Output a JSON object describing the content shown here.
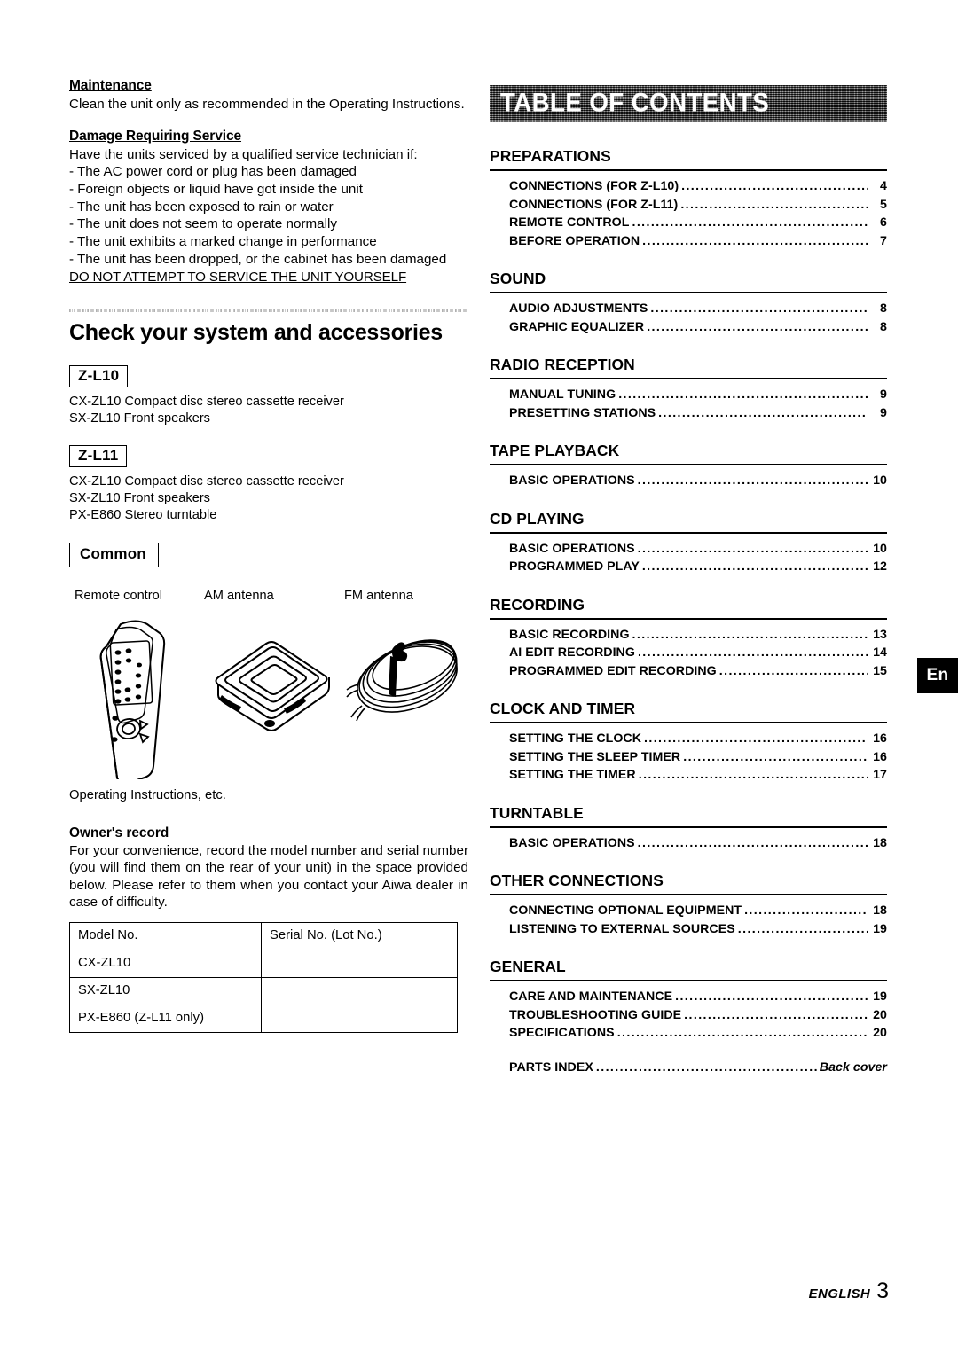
{
  "left": {
    "maintenance": {
      "heading": "Maintenance",
      "body": "Clean the unit only as recommended in the Operating Instructions."
    },
    "damage": {
      "heading": "Damage Requiring Service",
      "intro": "Have the units serviced by a qualified service technician if:",
      "items": [
        "- The AC power cord or plug has been damaged",
        "- Foreign objects or liquid have got inside the unit",
        "- The unit has been exposed to rain or water",
        "- The unit does not seem to operate normally",
        "- The unit exhibits a marked change in performance",
        "- The unit has been dropped, or the cabinet has been damaged"
      ],
      "warning": "DO NOT ATTEMPT TO SERVICE THE UNIT YOURSELF"
    },
    "check_heading": "Check your system and accessories",
    "packages": [
      {
        "label": "Z-L10",
        "contents": [
          "CX-ZL10 Compact disc stereo cassette receiver",
          "SX-ZL10 Front speakers"
        ]
      },
      {
        "label": "Z-L11",
        "contents": [
          "CX-ZL10 Compact disc stereo cassette receiver",
          "SX-ZL10 Front speakers",
          "PX-E860 Stereo turntable"
        ]
      }
    ],
    "common": {
      "label": "Common",
      "accessories": [
        {
          "name": "Remote control",
          "icon": "remote-control-icon"
        },
        {
          "name": "AM antenna",
          "icon": "am-loop-antenna-icon"
        },
        {
          "name": "FM antenna",
          "icon": "fm-wire-antenna-icon"
        }
      ],
      "extra": "Operating Instructions, etc."
    },
    "owner": {
      "heading": "Owner's record",
      "body": "For your convenience, record the model number and serial number (you will find them on the rear of your unit) in the space provided below. Please refer to them when you contact your Aiwa dealer in case of difficulty.",
      "table": {
        "headers": [
          "Model No.",
          "Serial No. (Lot No.)"
        ],
        "rows": [
          [
            "CX-ZL10",
            ""
          ],
          [
            "SX-ZL10",
            ""
          ],
          [
            "PX-E860 (Z-L11 only)",
            ""
          ]
        ]
      }
    }
  },
  "right": {
    "banner_title": "TABLE OF CONTENTS",
    "groups": [
      {
        "title": "PREPARATIONS",
        "entries": [
          {
            "label": "CONNECTIONS (FOR Z-L10)",
            "page": "4"
          },
          {
            "label": "CONNECTIONS (FOR Z-L11)",
            "page": "5"
          },
          {
            "label": "REMOTE CONTROL",
            "page": "6"
          },
          {
            "label": "BEFORE OPERATION",
            "page": "7"
          }
        ]
      },
      {
        "title": "SOUND",
        "entries": [
          {
            "label": "AUDIO ADJUSTMENTS",
            "page": "8"
          },
          {
            "label": "GRAPHIC EQUALIZER",
            "page": "8"
          }
        ]
      },
      {
        "title": "RADIO RECEPTION",
        "entries": [
          {
            "label": "MANUAL TUNING",
            "page": "9"
          },
          {
            "label": "PRESETTING STATIONS",
            "page": "9"
          }
        ]
      },
      {
        "title": "TAPE PLAYBACK",
        "entries": [
          {
            "label": "BASIC OPERATIONS",
            "page": "10"
          }
        ]
      },
      {
        "title": "CD PLAYING",
        "entries": [
          {
            "label": "BASIC OPERATIONS",
            "page": "10"
          },
          {
            "label": "PROGRAMMED PLAY",
            "page": "12"
          }
        ]
      },
      {
        "title": "RECORDING",
        "entries": [
          {
            "label": "BASIC RECORDING",
            "page": "13"
          },
          {
            "label": "AI EDIT RECORDING",
            "page": "14"
          },
          {
            "label": "PROGRAMMED EDIT RECORDING",
            "page": "15"
          }
        ]
      },
      {
        "title": "CLOCK AND TIMER",
        "entries": [
          {
            "label": "SETTING THE CLOCK",
            "page": "16"
          },
          {
            "label": "SETTING THE SLEEP TIMER",
            "page": "16"
          },
          {
            "label": "SETTING THE TIMER",
            "page": "17"
          }
        ]
      },
      {
        "title": "TURNTABLE",
        "entries": [
          {
            "label": "BASIC OPERATIONS",
            "page": "18"
          }
        ]
      },
      {
        "title": "OTHER CONNECTIONS",
        "entries": [
          {
            "label": "CONNECTING OPTIONAL EQUIPMENT",
            "page": "18"
          },
          {
            "label": "LISTENING TO EXTERNAL SOURCES",
            "page": "19"
          }
        ]
      },
      {
        "title": "GENERAL",
        "entries": [
          {
            "label": "CARE AND MAINTENANCE",
            "page": "19"
          },
          {
            "label": "TROUBLESHOOTING GUIDE",
            "page": "20"
          },
          {
            "label": "SPECIFICATIONS",
            "page": "20"
          }
        ]
      }
    ],
    "parts_index": {
      "label": "PARTS INDEX",
      "page": "Back cover"
    }
  },
  "language_tab": "En",
  "footer": {
    "language": "ENGLISH",
    "page_number": "3"
  }
}
